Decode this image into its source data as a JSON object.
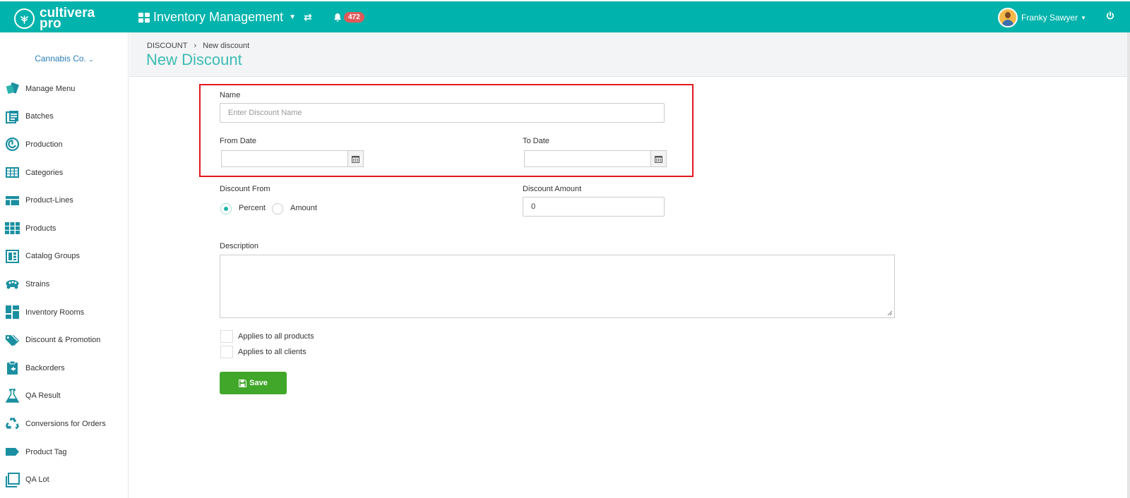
{
  "brand": {
    "line1": "cultivera",
    "line2": "pro"
  },
  "topbar": {
    "app_title": "Inventory Management",
    "notification_count": "472",
    "user_name": "Franky Sawyer"
  },
  "sidebar": {
    "company": "Cannabis Co.",
    "items": [
      {
        "label": "Manage Menu",
        "icon": "tag-cards-icon"
      },
      {
        "label": "Batches",
        "icon": "document-icon"
      },
      {
        "label": "Production",
        "icon": "spiral-icon"
      },
      {
        "label": "Categories",
        "icon": "table-icon"
      },
      {
        "label": "Product-Lines",
        "icon": "layout-icon"
      },
      {
        "label": "Products",
        "icon": "grid-icon"
      },
      {
        "label": "Catalog Groups",
        "icon": "catalog-icon"
      },
      {
        "label": "Strains",
        "icon": "cells-icon"
      },
      {
        "label": "Inventory Rooms",
        "icon": "dashboard-icon"
      },
      {
        "label": "Discount & Promotion",
        "icon": "tags-icon"
      },
      {
        "label": "Backorders",
        "icon": "clipboard-icon"
      },
      {
        "label": "QA Result",
        "icon": "flask-icon"
      },
      {
        "label": "Conversions for Orders",
        "icon": "recycle-icon"
      },
      {
        "label": "Product Tag",
        "icon": "label-icon"
      },
      {
        "label": "QA Lot",
        "icon": "copy-icon"
      }
    ]
  },
  "breadcrumb": {
    "root": "DISCOUNT",
    "current": "New discount"
  },
  "page": {
    "title": "New Discount"
  },
  "form": {
    "name_label": "Name",
    "name_placeholder": "Enter Discount Name",
    "from_date_label": "From Date",
    "to_date_label": "To Date",
    "discount_from_label": "Discount From",
    "percent_label": "Percent",
    "amount_label": "Amount",
    "discount_amount_label": "Discount Amount",
    "discount_amount_value": "0",
    "description_label": "Description",
    "applies_products_label": "Applies to all products",
    "applies_clients_label": "Applies to all clients",
    "save_label": "Save"
  },
  "colors": {
    "teal": "#00b3ac",
    "title_teal": "#3cbcb4",
    "save_green": "#41a72a",
    "highlight_red": "#e0191e",
    "badge_red": "#e05a5a"
  }
}
